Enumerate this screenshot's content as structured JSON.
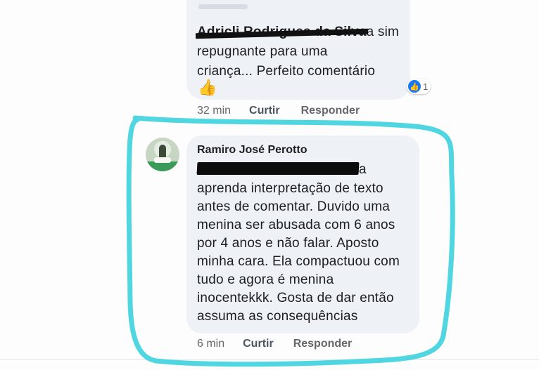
{
  "comment_1": {
    "author_redacted": "Adricli Rodrigues da Silva",
    "text_lines": [
      "a sim",
      "repugnante para uma",
      "criança... Perfeito comentário"
    ],
    "emoji": "👍",
    "reaction_count": "1",
    "time": "32 min",
    "like_label": "Curtir",
    "reply_label": "Responder"
  },
  "comment_2": {
    "author": "Ramiro José Perotto",
    "mention_suffix": "a",
    "text_lines": [
      "aprenda interpretação de texto",
      "antes de comentar. Duvido uma",
      "menina ser abusada com 6 anos",
      "por 4 anos e não falar. Aposto",
      "minha cara. Ela compactuou com",
      "tudo e agora é menina",
      "inocentekkk. Gosta de dar então",
      "assuma as consequências"
    ],
    "time": "6 min",
    "like_label": "Curtir",
    "reply_label": "Responder"
  },
  "colors": {
    "bubble": "#eef1f6",
    "highlight_marker": "#4fd6e0",
    "like_blue": "#1877f2"
  }
}
